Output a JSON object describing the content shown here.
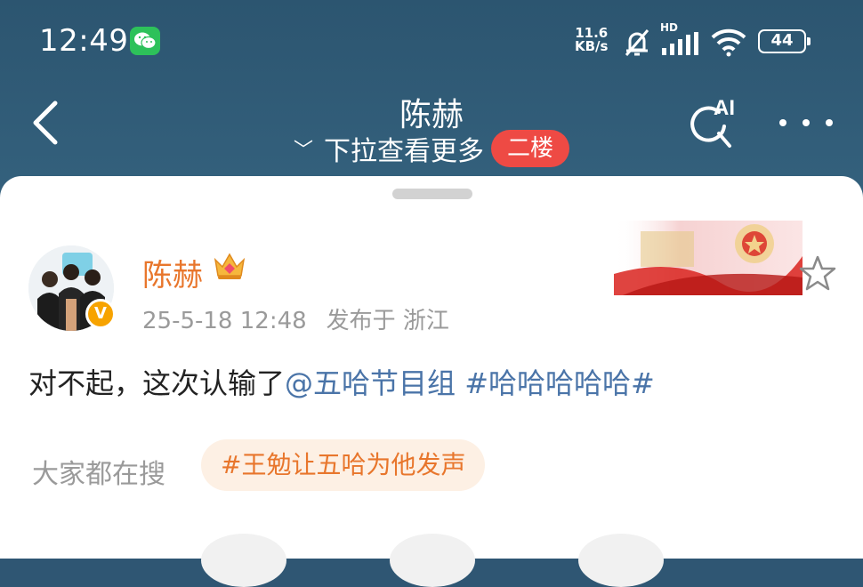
{
  "status": {
    "time": "12:49",
    "net_speed_value": "11.6",
    "net_speed_unit": "KB/s",
    "signal_label": "HD",
    "battery": "44",
    "icons": [
      "wechat-icon",
      "mute-bell-icon",
      "signal-icon",
      "wifi-icon",
      "battery-icon"
    ]
  },
  "header": {
    "title": "陈赫",
    "pull_hint": "下拉查看更多",
    "floor_badge": "二楼",
    "ai_label": "AI",
    "colors": {
      "bar": "#2f5673",
      "badge": "#ee4a44"
    }
  },
  "post": {
    "username": "陈赫",
    "timestamp": "25-5-18 12:48",
    "location": "发布于 浙江",
    "text_main": "对不起，这次认输了",
    "mention": "@五哈节目组",
    "hashtag": " #哈哈哈哈哈#",
    "colors": {
      "username": "#e8762c",
      "link": "#4a74a8"
    }
  },
  "search": {
    "label": "大家都在搜",
    "hot_topic": "#王勉让五哈为他发声"
  }
}
